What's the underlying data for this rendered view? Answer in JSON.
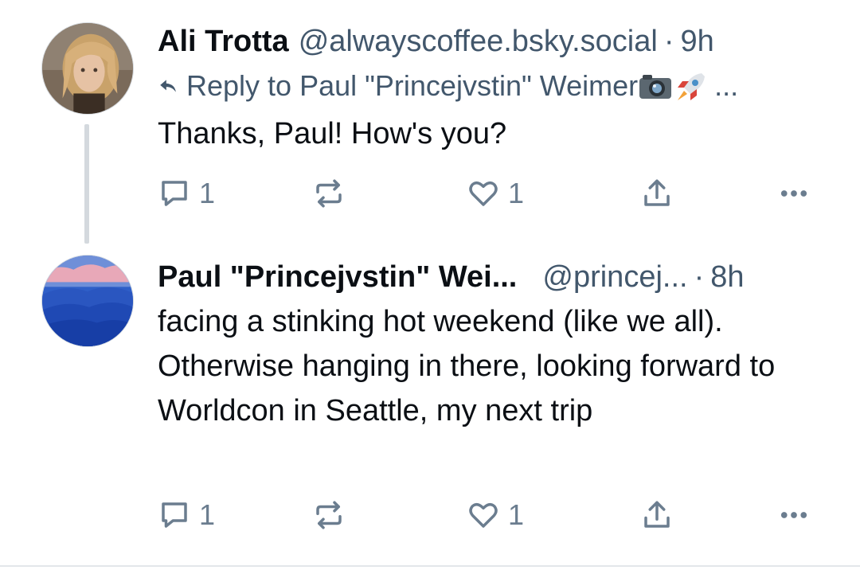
{
  "posts": [
    {
      "author_name": "Ali Trotta",
      "handle": "@alwayscoffee.bsky.social",
      "separator": "·",
      "time": "9h",
      "reply_to": "Reply to Paul \"Princejvstin\" Weimer",
      "reply_to_emojis": [
        "camera-emoji",
        "rocket-emoji"
      ],
      "reply_to_ellipsis": "...",
      "text": "Thanks, Paul! How's you?",
      "reply_count": "1",
      "like_count": "1"
    },
    {
      "author_name": "Paul \"Princejvstin\" Wei...",
      "handle": "@princej...",
      "separator": "·",
      "time": "8h",
      "text": "facing a stinking hot weekend (like we all). Otherwise hanging in there, looking forward to Worldcon in Seattle, my next trip",
      "reply_count": "1",
      "like_count": "1"
    }
  ],
  "icons": {
    "reply": "reply-bubble-icon",
    "repost": "repost-arrows-icon",
    "like": "heart-icon",
    "share": "share-upload-icon",
    "more": "more-dots-icon"
  },
  "colors": {
    "text_primary": "#0b0f14",
    "text_secondary": "#42576c",
    "icon_gray": "#6b7d8f",
    "thread_line": "#d4d9de"
  }
}
